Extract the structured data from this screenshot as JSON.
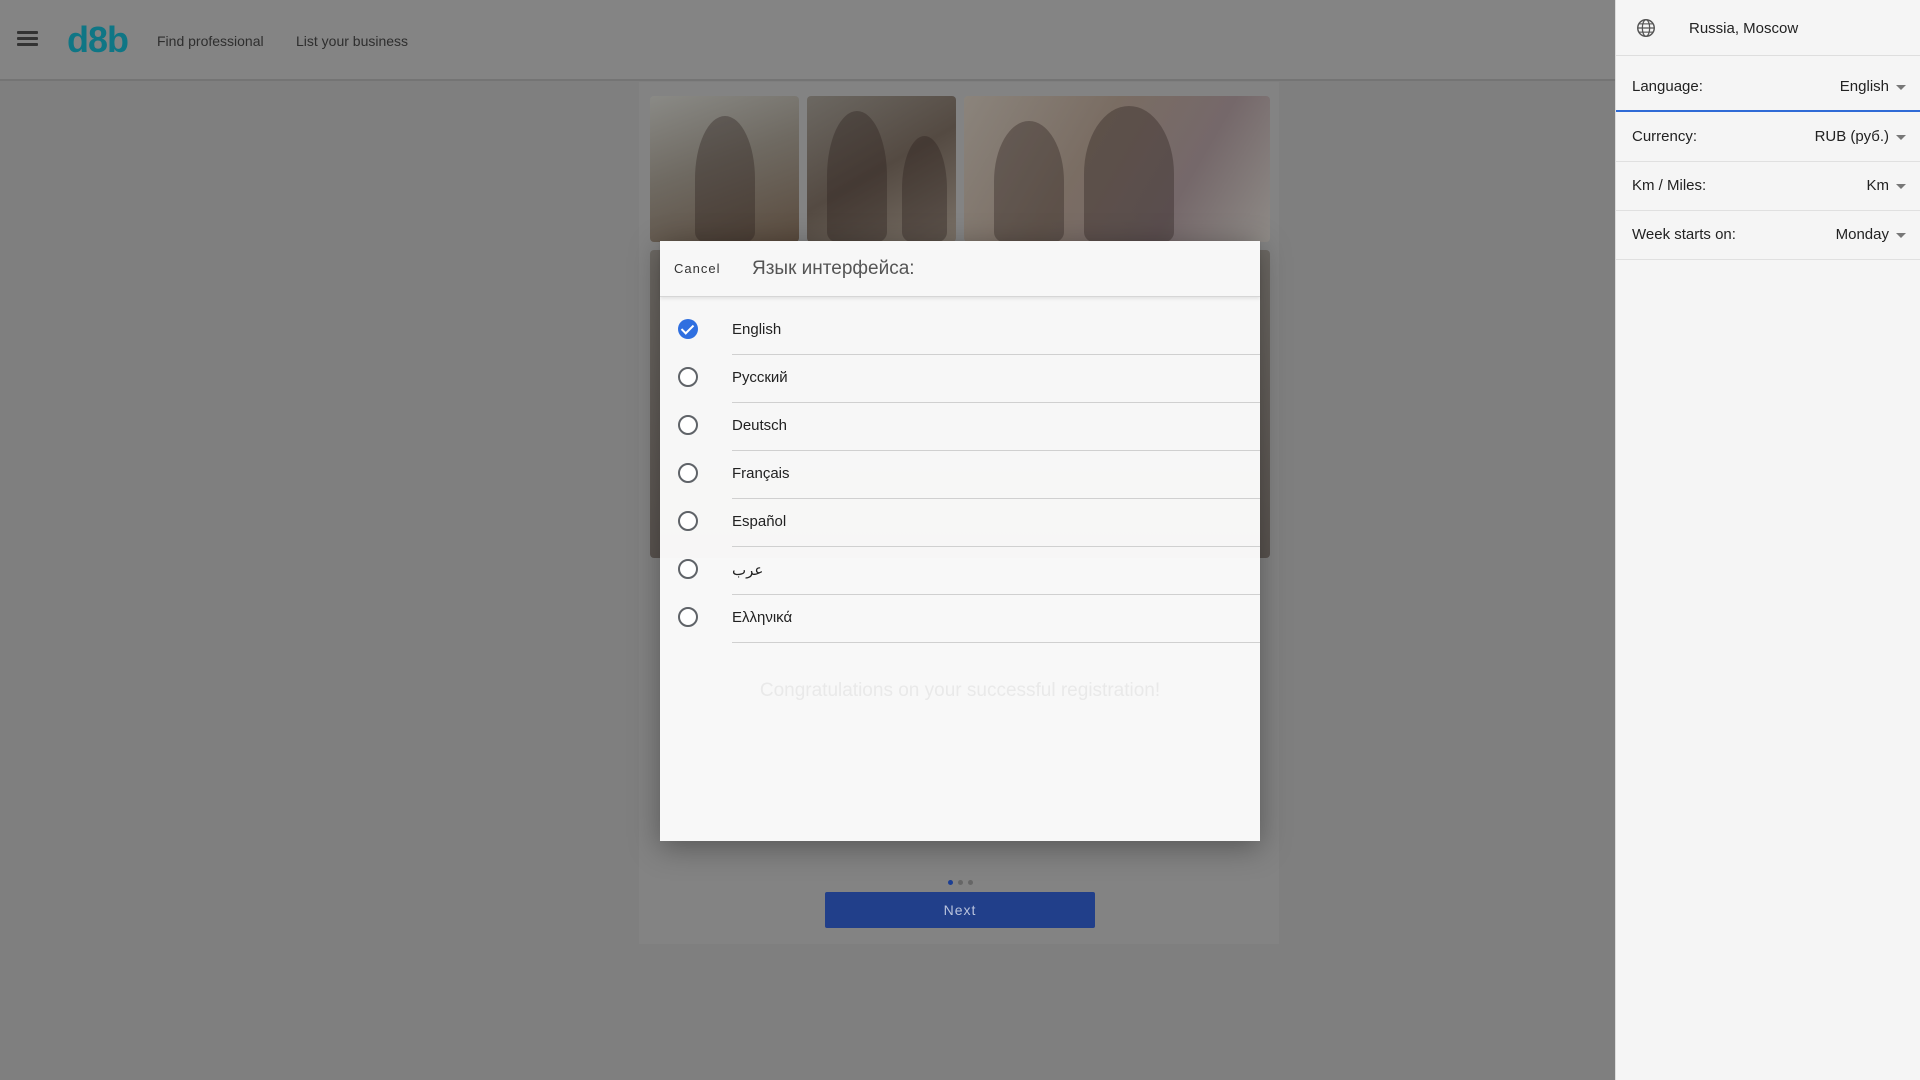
{
  "header": {
    "logo": "d8b",
    "nav": [
      "Find professional",
      "List your business"
    ]
  },
  "modal": {
    "cancel_label": "Cancel",
    "title": "Язык интерфейса:",
    "languages": [
      {
        "label": "English",
        "selected": true
      },
      {
        "label": "Русский",
        "selected": false
      },
      {
        "label": "Deutsch",
        "selected": false
      },
      {
        "label": "Français",
        "selected": false
      },
      {
        "label": "Español",
        "selected": false
      },
      {
        "label": "عرب",
        "selected": false
      },
      {
        "label": "Ελληνικά",
        "selected": false
      }
    ],
    "background_heading": "Congratulations on your successful registration!"
  },
  "page": {
    "next_label": "Next",
    "pager_dots": 3,
    "pager_active": 0
  },
  "settings_panel": {
    "location": "Russia, Moscow",
    "rows": [
      {
        "label": "Language:",
        "value": "English"
      },
      {
        "label": "Currency:",
        "value": "RUB (руб.)"
      },
      {
        "label": "Km / Miles:",
        "value": "Km"
      },
      {
        "label": "Week starts on:",
        "value": "Monday"
      }
    ]
  },
  "colors": {
    "accent": "#2f6fe0",
    "brand": "#0f7685",
    "next_button": "#213f8a"
  }
}
